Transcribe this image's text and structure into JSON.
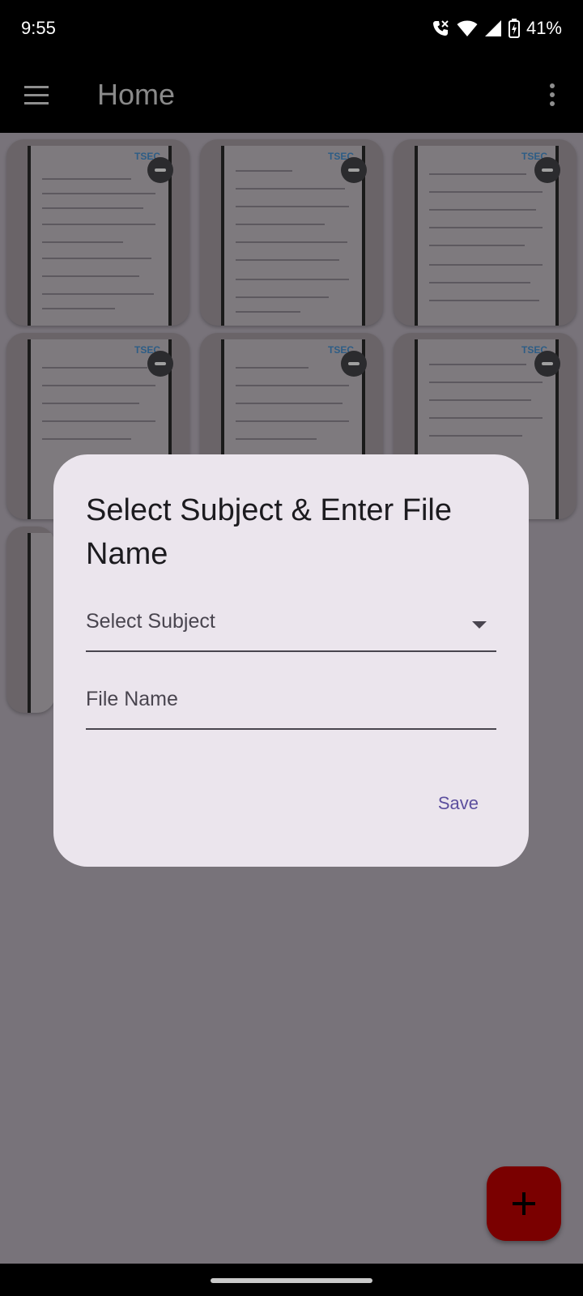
{
  "status_bar": {
    "time": "9:55",
    "battery": "41%"
  },
  "app_bar": {
    "title": "Home"
  },
  "pages": [
    {
      "stamp": "TSEC"
    },
    {
      "stamp": "TSEC"
    },
    {
      "stamp": "TSEC"
    },
    {
      "stamp": "TSEC"
    },
    {
      "stamp": "TSEC"
    },
    {
      "stamp": "TSEC"
    },
    {
      "stamp": ""
    }
  ],
  "dialog": {
    "title": "Select Subject & Enter File Name",
    "subject_label": "Select Subject",
    "file_name_label": "File Name",
    "save_label": "Save"
  },
  "colors": {
    "scrim": "#78737a",
    "dialog_bg": "#ebe5ed",
    "accent": "#5c4f9e",
    "fab": "#7a0000"
  },
  "icons": {
    "menu": "menu-icon",
    "more": "more-vert-icon",
    "remove": "remove-icon",
    "dropdown": "arrow-drop-down-icon",
    "add": "add-icon"
  }
}
